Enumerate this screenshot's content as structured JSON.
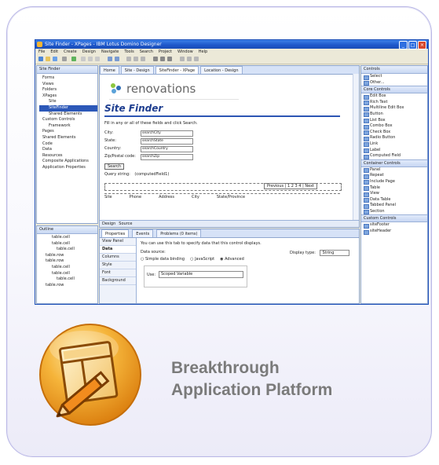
{
  "window": {
    "title": "Site Finder - XPages - IBM Lotus Domino Designer",
    "minimize_label": "_",
    "maximize_label": "□",
    "close_label": "×"
  },
  "menu": [
    "File",
    "Edit",
    "Create",
    "Design",
    "Navigate",
    "Tools",
    "Search",
    "Project",
    "Window",
    "Help"
  ],
  "navigator": {
    "header": "Site Finder",
    "items": [
      "Forms",
      "Views",
      "Folders",
      "XPages",
      "Site",
      "SiteFinder",
      "Shared Elements",
      "Custom Controls",
      "Framework",
      "Pages",
      "Shared Elements",
      "Code",
      "Data",
      "Resources",
      "Composite Applications",
      "Application Properties"
    ],
    "selected_item": "SiteFinder"
  },
  "outline": {
    "header": "Outline",
    "items": [
      "table.cell",
      "table.cell",
      "table.cell",
      "table.row",
      "table.row",
      "table.cell",
      "table.cell",
      "table.cell",
      "table.row"
    ]
  },
  "editor": {
    "tabs": [
      "Home",
      "Site - Design",
      "SiteFinder - XPage",
      "Location - Design"
    ],
    "logo_text": "renovations",
    "page_title": "Site Finder",
    "intro_text": "Fill in any or all of these fields and click Search.",
    "fields": [
      {
        "label": "City:",
        "value": "searchCity"
      },
      {
        "label": "State:",
        "value": "searchState"
      },
      {
        "label": "Country:",
        "value": "searchCountry"
      },
      {
        "label": "Zip/Postal code:",
        "value": "searchZip"
      }
    ],
    "search_button": "Search",
    "query_label": "Query string:",
    "query_value": "(computedField1)",
    "pager_text": "Previous | 1 2 3 4 | Next",
    "table_headers": [
      "Site",
      "Phone",
      "Address",
      "City",
      "State/Province"
    ],
    "bottom_tabs": [
      "Design",
      "Source"
    ]
  },
  "properties": {
    "tabs": [
      "Properties",
      "Events",
      "Problems (0 items)"
    ],
    "vertical_tabs": [
      "View Panel",
      "Data",
      "Columns",
      "Style",
      "Font",
      "Background"
    ],
    "description": "You can use this tab to specify data that this control displays.",
    "data_label": "Data source:",
    "radio_options": [
      "Simple data binding",
      "JavaScript",
      "Advanced"
    ],
    "selected_option": "Advanced",
    "select_label": "Use:",
    "select_value": "Scoped Variable",
    "display_type_label": "Display type:",
    "display_type_value": "String"
  },
  "palette": {
    "header": "Controls",
    "tools": [
      "Select",
      "Other..."
    ],
    "groups": [
      {
        "name": "Core Controls",
        "items": [
          "Edit Box",
          "Rich Text",
          "Multiline Edit Box",
          "Button",
          "List Box",
          "Combo Box",
          "Check Box",
          "Radio Button",
          "Link",
          "Label",
          "Computed Field"
        ]
      },
      {
        "name": "Container Controls",
        "items": [
          "Panel",
          "Repeat",
          "Include Page",
          "Table",
          "View",
          "Data Table",
          "Tabbed Panel",
          "Section"
        ]
      },
      {
        "name": "Custom Controls",
        "items": [
          "siteFooter",
          "siteHeader"
        ]
      }
    ]
  },
  "tagline": {
    "line1": "Breakthrough",
    "line2": "Application Platform"
  },
  "colors": {
    "titlebar": "#1d56c9",
    "accent": "#2c58b8",
    "tagline": "#7a7a7a",
    "icon_orange": "#f0a326"
  }
}
